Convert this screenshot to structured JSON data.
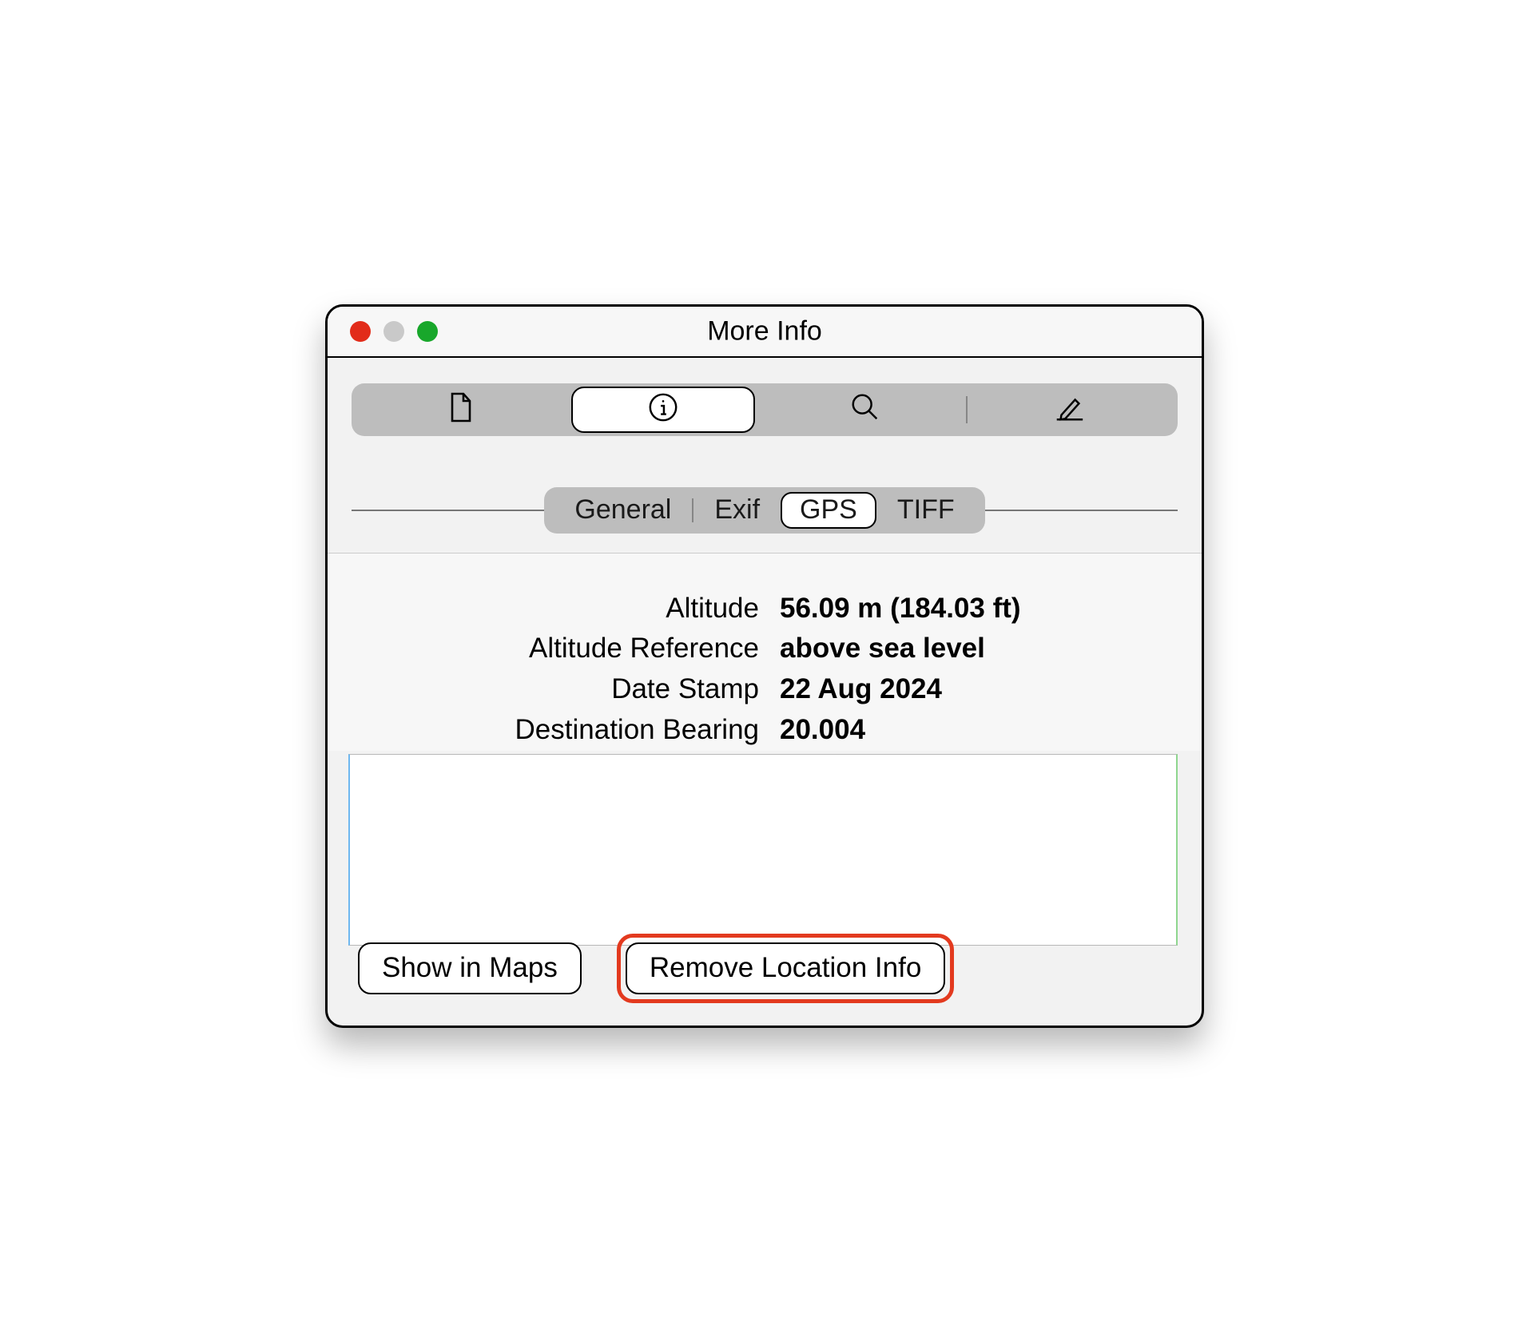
{
  "window": {
    "title": "More Info"
  },
  "toolbar": {
    "icons": [
      "file-icon",
      "info-icon",
      "search-icon",
      "pencil-icon"
    ],
    "selected_index": 1
  },
  "tabs": {
    "items": [
      "General",
      "Exif",
      "GPS",
      "TIFF"
    ],
    "selected_index": 2
  },
  "gps": {
    "rows": [
      {
        "label": "Altitude",
        "value": "56.09 m (184.03 ft)"
      },
      {
        "label": "Altitude Reference",
        "value": "above sea level"
      },
      {
        "label": "Date Stamp",
        "value": "22 Aug 2024"
      },
      {
        "label": "Destination Bearing",
        "value": "20.004"
      }
    ]
  },
  "buttons": {
    "show_in_maps": "Show in Maps",
    "remove_location_info": "Remove Location Info"
  },
  "highlight": {
    "target": "remove-location-info-button",
    "color": "#e33a1f"
  }
}
